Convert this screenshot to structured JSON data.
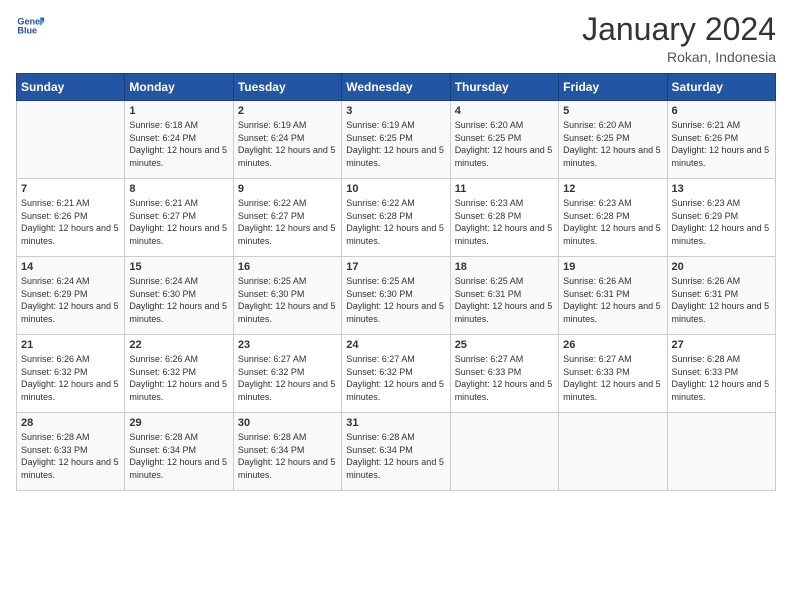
{
  "logo": {
    "line1": "General",
    "line2": "Blue"
  },
  "title": "January 2024",
  "subtitle": "Rokan, Indonesia",
  "days": [
    "Sunday",
    "Monday",
    "Tuesday",
    "Wednesday",
    "Thursday",
    "Friday",
    "Saturday"
  ],
  "weeks": [
    [
      {
        "day": "",
        "sunrise": "",
        "sunset": "",
        "daylight": ""
      },
      {
        "day": "1",
        "sunrise": "6:18 AM",
        "sunset": "6:24 PM",
        "daylight": "12 hours and 5 minutes."
      },
      {
        "day": "2",
        "sunrise": "6:19 AM",
        "sunset": "6:24 PM",
        "daylight": "12 hours and 5 minutes."
      },
      {
        "day": "3",
        "sunrise": "6:19 AM",
        "sunset": "6:25 PM",
        "daylight": "12 hours and 5 minutes."
      },
      {
        "day": "4",
        "sunrise": "6:20 AM",
        "sunset": "6:25 PM",
        "daylight": "12 hours and 5 minutes."
      },
      {
        "day": "5",
        "sunrise": "6:20 AM",
        "sunset": "6:25 PM",
        "daylight": "12 hours and 5 minutes."
      },
      {
        "day": "6",
        "sunrise": "6:21 AM",
        "sunset": "6:26 PM",
        "daylight": "12 hours and 5 minutes."
      }
    ],
    [
      {
        "day": "7",
        "sunrise": "6:21 AM",
        "sunset": "6:26 PM",
        "daylight": "12 hours and 5 minutes."
      },
      {
        "day": "8",
        "sunrise": "6:21 AM",
        "sunset": "6:27 PM",
        "daylight": "12 hours and 5 minutes."
      },
      {
        "day": "9",
        "sunrise": "6:22 AM",
        "sunset": "6:27 PM",
        "daylight": "12 hours and 5 minutes."
      },
      {
        "day": "10",
        "sunrise": "6:22 AM",
        "sunset": "6:28 PM",
        "daylight": "12 hours and 5 minutes."
      },
      {
        "day": "11",
        "sunrise": "6:23 AM",
        "sunset": "6:28 PM",
        "daylight": "12 hours and 5 minutes."
      },
      {
        "day": "12",
        "sunrise": "6:23 AM",
        "sunset": "6:28 PM",
        "daylight": "12 hours and 5 minutes."
      },
      {
        "day": "13",
        "sunrise": "6:23 AM",
        "sunset": "6:29 PM",
        "daylight": "12 hours and 5 minutes."
      }
    ],
    [
      {
        "day": "14",
        "sunrise": "6:24 AM",
        "sunset": "6:29 PM",
        "daylight": "12 hours and 5 minutes."
      },
      {
        "day": "15",
        "sunrise": "6:24 AM",
        "sunset": "6:30 PM",
        "daylight": "12 hours and 5 minutes."
      },
      {
        "day": "16",
        "sunrise": "6:25 AM",
        "sunset": "6:30 PM",
        "daylight": "12 hours and 5 minutes."
      },
      {
        "day": "17",
        "sunrise": "6:25 AM",
        "sunset": "6:30 PM",
        "daylight": "12 hours and 5 minutes."
      },
      {
        "day": "18",
        "sunrise": "6:25 AM",
        "sunset": "6:31 PM",
        "daylight": "12 hours and 5 minutes."
      },
      {
        "day": "19",
        "sunrise": "6:26 AM",
        "sunset": "6:31 PM",
        "daylight": "12 hours and 5 minutes."
      },
      {
        "day": "20",
        "sunrise": "6:26 AM",
        "sunset": "6:31 PM",
        "daylight": "12 hours and 5 minutes."
      }
    ],
    [
      {
        "day": "21",
        "sunrise": "6:26 AM",
        "sunset": "6:32 PM",
        "daylight": "12 hours and 5 minutes."
      },
      {
        "day": "22",
        "sunrise": "6:26 AM",
        "sunset": "6:32 PM",
        "daylight": "12 hours and 5 minutes."
      },
      {
        "day": "23",
        "sunrise": "6:27 AM",
        "sunset": "6:32 PM",
        "daylight": "12 hours and 5 minutes."
      },
      {
        "day": "24",
        "sunrise": "6:27 AM",
        "sunset": "6:32 PM",
        "daylight": "12 hours and 5 minutes."
      },
      {
        "day": "25",
        "sunrise": "6:27 AM",
        "sunset": "6:33 PM",
        "daylight": "12 hours and 5 minutes."
      },
      {
        "day": "26",
        "sunrise": "6:27 AM",
        "sunset": "6:33 PM",
        "daylight": "12 hours and 5 minutes."
      },
      {
        "day": "27",
        "sunrise": "6:28 AM",
        "sunset": "6:33 PM",
        "daylight": "12 hours and 5 minutes."
      }
    ],
    [
      {
        "day": "28",
        "sunrise": "6:28 AM",
        "sunset": "6:33 PM",
        "daylight": "12 hours and 5 minutes."
      },
      {
        "day": "29",
        "sunrise": "6:28 AM",
        "sunset": "6:34 PM",
        "daylight": "12 hours and 5 minutes."
      },
      {
        "day": "30",
        "sunrise": "6:28 AM",
        "sunset": "6:34 PM",
        "daylight": "12 hours and 5 minutes."
      },
      {
        "day": "31",
        "sunrise": "6:28 AM",
        "sunset": "6:34 PM",
        "daylight": "12 hours and 5 minutes."
      },
      {
        "day": "",
        "sunrise": "",
        "sunset": "",
        "daylight": ""
      },
      {
        "day": "",
        "sunrise": "",
        "sunset": "",
        "daylight": ""
      },
      {
        "day": "",
        "sunrise": "",
        "sunset": "",
        "daylight": ""
      }
    ]
  ]
}
